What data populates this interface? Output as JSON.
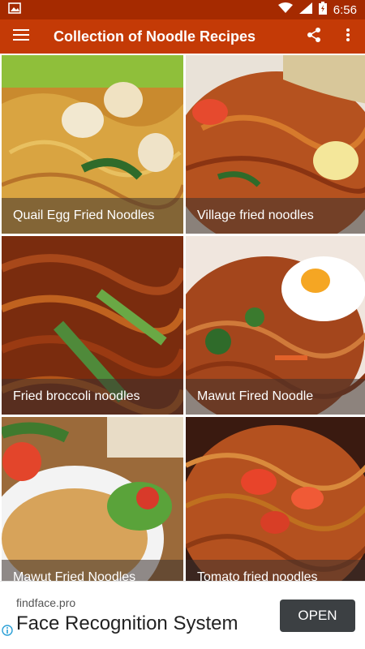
{
  "status_bar": {
    "time": "6:56",
    "icons": [
      "image-icon",
      "wifi-icon",
      "signal-icon",
      "battery-icon"
    ]
  },
  "app_bar": {
    "title": "Collection of Noodle Recipes",
    "menu_icon": "menu-icon",
    "share_icon": "share-icon",
    "more_icon": "more-vert-icon"
  },
  "recipes": [
    {
      "title": "Quail Egg Fried Noodles"
    },
    {
      "title": "Village fried noodles"
    },
    {
      "title": "Fried broccoli noodles"
    },
    {
      "title": "Mawut Fired Noodle"
    },
    {
      "title": "Mawut Fried Noodles"
    },
    {
      "title": "Tomato fried noodles"
    }
  ],
  "ad": {
    "domain": "findface.pro",
    "headline": "Face Recognition System",
    "button_label": "OPEN",
    "info_icon": "adchoices-info-icon"
  },
  "colors": {
    "status_bar": "#a52a00",
    "app_bar": "#c43a06",
    "ad_button": "#3c4043"
  }
}
